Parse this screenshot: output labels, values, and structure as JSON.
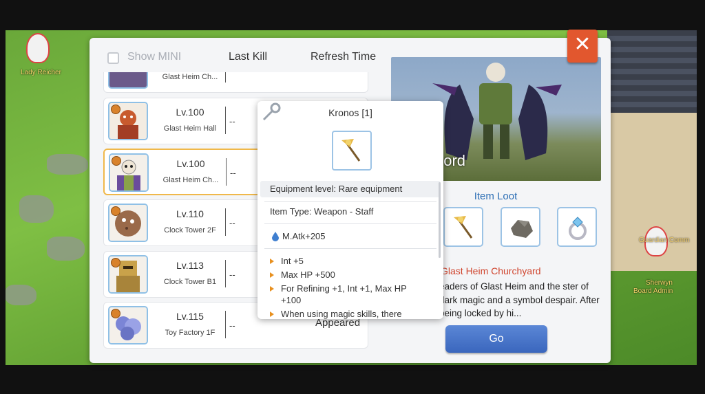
{
  "world": {
    "npc_left_label": "Lady Reicher",
    "npc_right_label1": "Guardian Comm",
    "npc_right_label2": "Sherwyn",
    "npc_right_label3": "Board Admin"
  },
  "header": {
    "show_mini_label": "Show MINI",
    "last_kill_label": "Last Kill",
    "refresh_time_label": "Refresh Time"
  },
  "bosses": [
    {
      "level": "",
      "location": "Glast Heim Ch...",
      "last_kill": ""
    },
    {
      "level": "Lv.100",
      "location": "Glast Heim Hall",
      "last_kill": "--"
    },
    {
      "level": "Lv.100",
      "location": "Glast Heim Ch...",
      "last_kill": "--"
    },
    {
      "level": "Lv.110",
      "location": "Clock Tower 2F",
      "last_kill": "--"
    },
    {
      "level": "Lv.113",
      "location": "Clock Tower B1",
      "last_kill": "--"
    },
    {
      "level": "Lv.115",
      "location": "Toy Factory 1F",
      "last_kill": "--"
    }
  ],
  "appeared_label": "Appeared",
  "detail": {
    "boss_name_partial": "ord",
    "item_loot_label": "Item Loot",
    "location_title": "Glast Heim Churchyard",
    "description": "eaders of Glast Heim and the ster of dark magic and a symbol despair. After being locked by hi...",
    "go_label": "Go",
    "close_glyph": "✕"
  },
  "tooltip": {
    "title": "Kronos [1]",
    "equipment_level": "Equipment level: Rare equipment",
    "item_type": "Item Type: Weapon - Staff",
    "matk": "M.Atk+205",
    "effects": [
      "Int +5",
      "Max HP +500",
      "For Refining +1, Int +1, Max HP +100",
      "When using magic skills, there"
    ]
  },
  "icons": {
    "tooltip_key": "key-icon",
    "staff": "staff-icon",
    "ore": "ore-icon",
    "ring": "ring-icon",
    "matk": "water-drop-icon"
  },
  "colors": {
    "accent_blue": "#2e6fb5",
    "close_red": "#e2572e",
    "location_red": "#d0452e",
    "selected_border": "#f0b84a"
  }
}
